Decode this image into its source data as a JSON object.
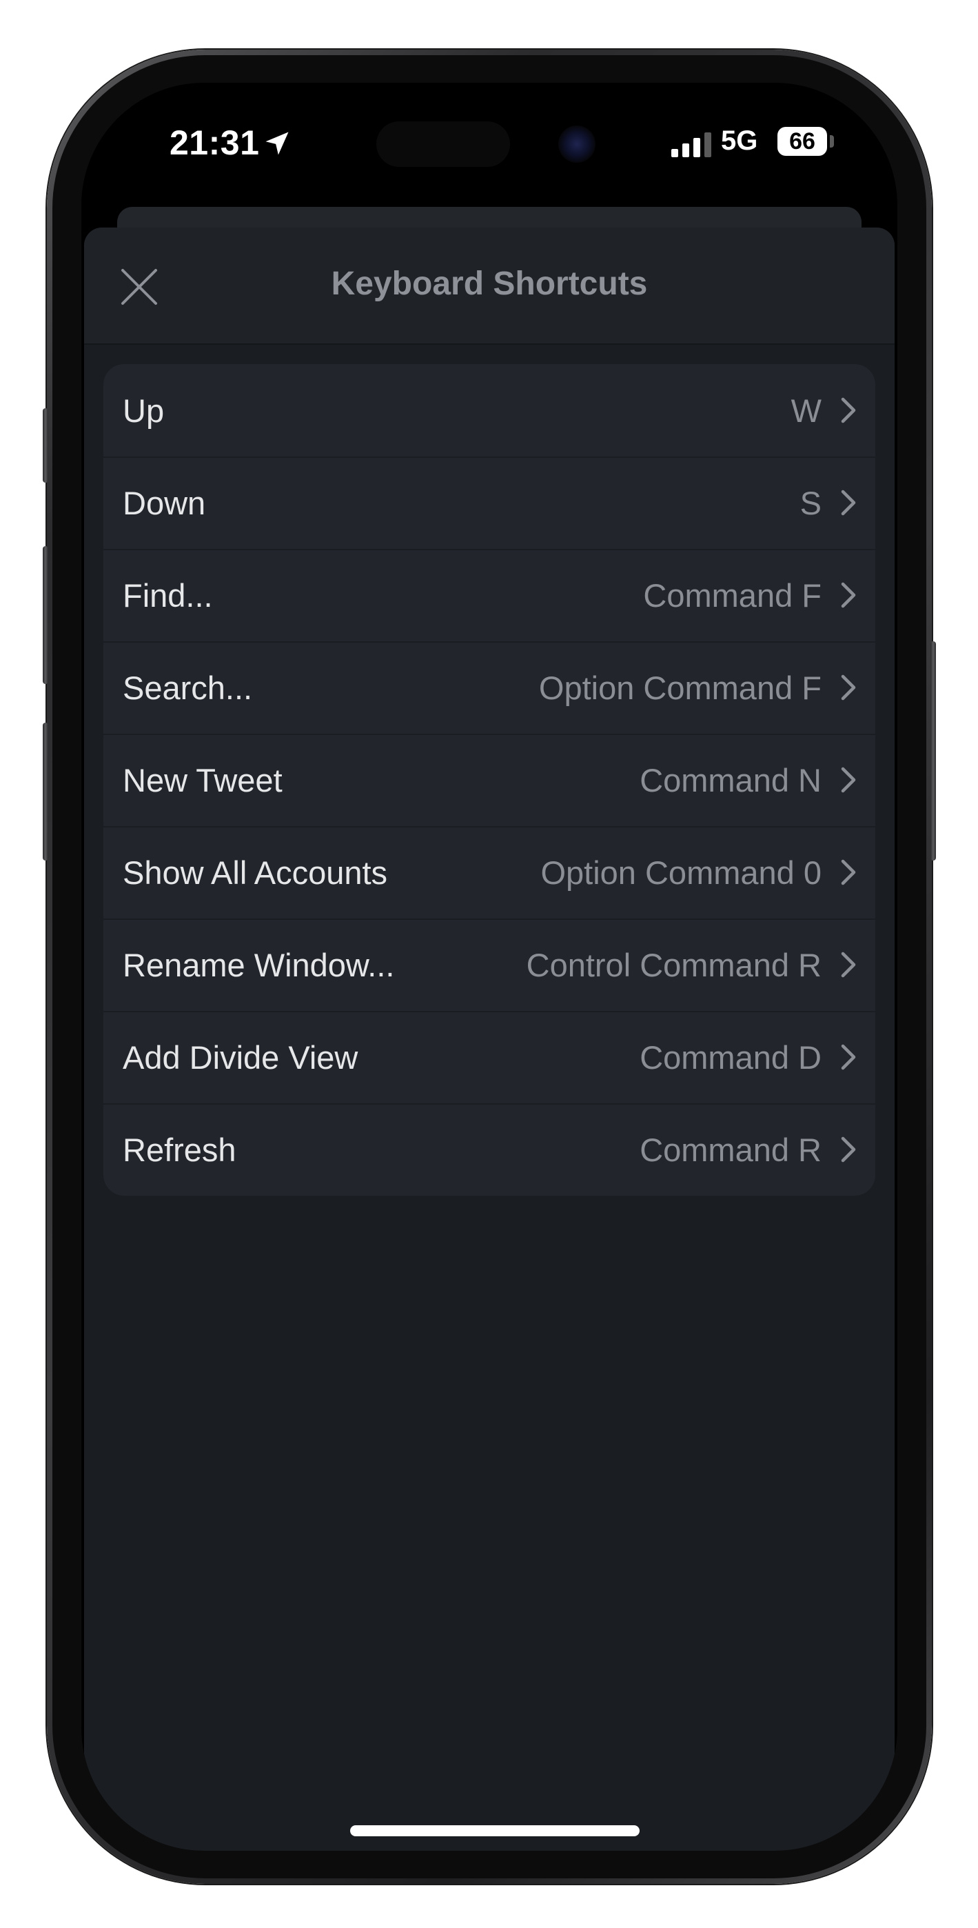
{
  "status_bar": {
    "time": "21:31",
    "network": "5G",
    "battery": "66"
  },
  "sheet": {
    "title": "Keyboard Shortcuts",
    "close_icon": "close-icon"
  },
  "shortcuts": [
    {
      "label": "Up",
      "value": "W"
    },
    {
      "label": "Down",
      "value": "S"
    },
    {
      "label": "Find...",
      "value": "Command F"
    },
    {
      "label": "Search...",
      "value": "Option Command F"
    },
    {
      "label": "New Tweet",
      "value": "Command N"
    },
    {
      "label": "Show All Accounts",
      "value": "Option Command 0"
    },
    {
      "label": "Rename Window...",
      "value": "Control Command R"
    },
    {
      "label": "Add Divide View",
      "value": "Command D"
    },
    {
      "label": "Refresh",
      "value": "Command R"
    }
  ],
  "colors": {
    "sheet_background": "#1a1d21",
    "list_background": "#22262c",
    "label_text": "#e6e7e9",
    "value_text": "#8b8f95"
  }
}
